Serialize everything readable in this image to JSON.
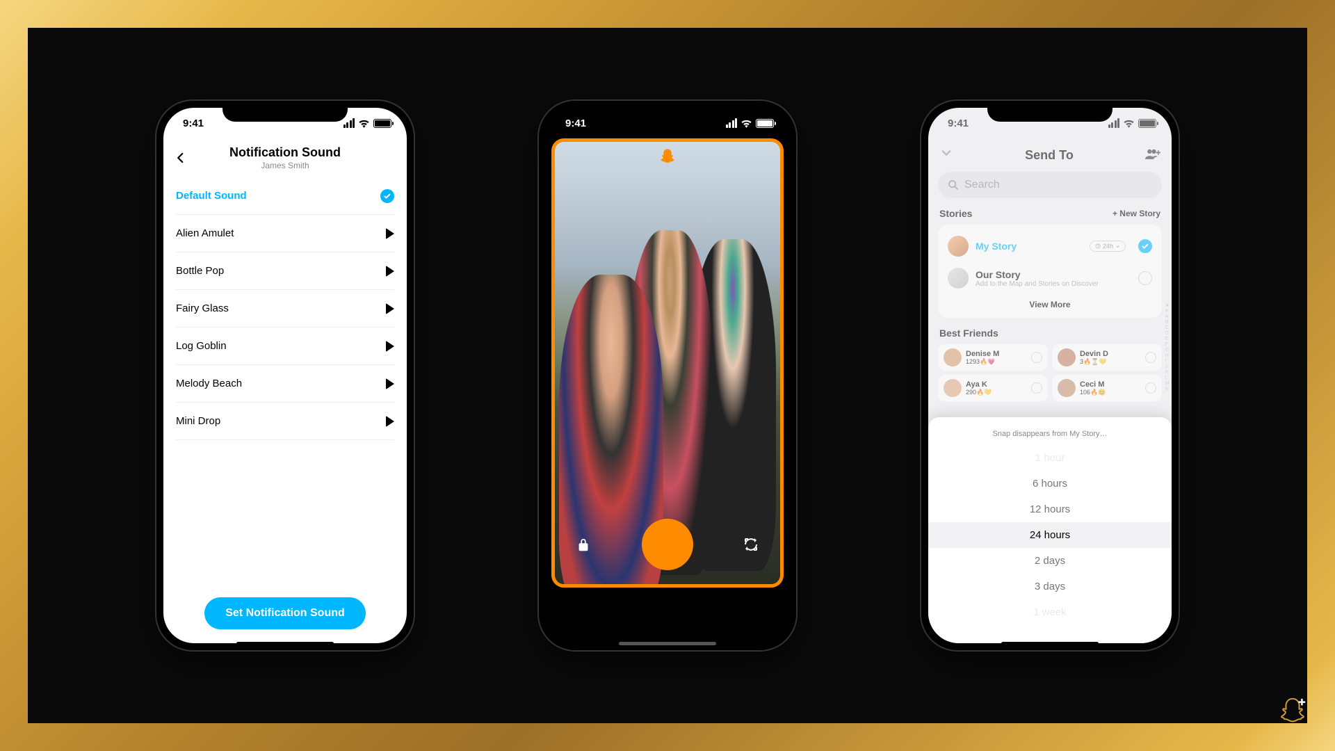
{
  "status": {
    "time": "9:41"
  },
  "phone1": {
    "title": "Notification Sound",
    "subtitle": "James Smith",
    "options": [
      {
        "label": "Default Sound",
        "selected": true
      },
      {
        "label": "Alien Amulet",
        "selected": false
      },
      {
        "label": "Bottle Pop",
        "selected": false
      },
      {
        "label": "Fairy Glass",
        "selected": false
      },
      {
        "label": "Log Goblin",
        "selected": false
      },
      {
        "label": "Melody Beach",
        "selected": false
      },
      {
        "label": "Mini Drop",
        "selected": false
      }
    ],
    "cta": "Set Notification Sound"
  },
  "phone3": {
    "title": "Send To",
    "search_placeholder": "Search",
    "stories_header": "Stories",
    "new_story": "+ New Story",
    "my_story": {
      "label": "My Story",
      "duration": "24h"
    },
    "our_story": {
      "label": "Our Story",
      "sub": "Add to the Map and Stories on Discover"
    },
    "view_more": "View More",
    "best_friends_header": "Best Friends",
    "friends": [
      {
        "name": "Denise M",
        "meta": "1293🔥💗",
        "color": "#d8a070"
      },
      {
        "name": "Devin D",
        "meta": "3🔥⏳💛",
        "color": "#c08060"
      },
      {
        "name": "Aya K",
        "meta": "290🔥💛",
        "color": "#e0a880"
      },
      {
        "name": "Ceci M",
        "meta": "106🔥😊",
        "color": "#c89070"
      }
    ],
    "sheet": {
      "title": "Snap disappears from My Story…",
      "options": [
        {
          "label": "1 hour",
          "state": "faded"
        },
        {
          "label": "6 hours",
          "state": "near"
        },
        {
          "label": "12 hours",
          "state": "near"
        },
        {
          "label": "24 hours",
          "state": "sel"
        },
        {
          "label": "2 days",
          "state": "near"
        },
        {
          "label": "3 days",
          "state": "near"
        },
        {
          "label": "1 week",
          "state": "faded"
        }
      ]
    },
    "alpha": [
      "★",
      "#",
      "A",
      "B",
      "C",
      "D",
      "E",
      "F",
      "G",
      "H",
      "I",
      "J",
      "K",
      "L",
      "M",
      "N"
    ]
  }
}
